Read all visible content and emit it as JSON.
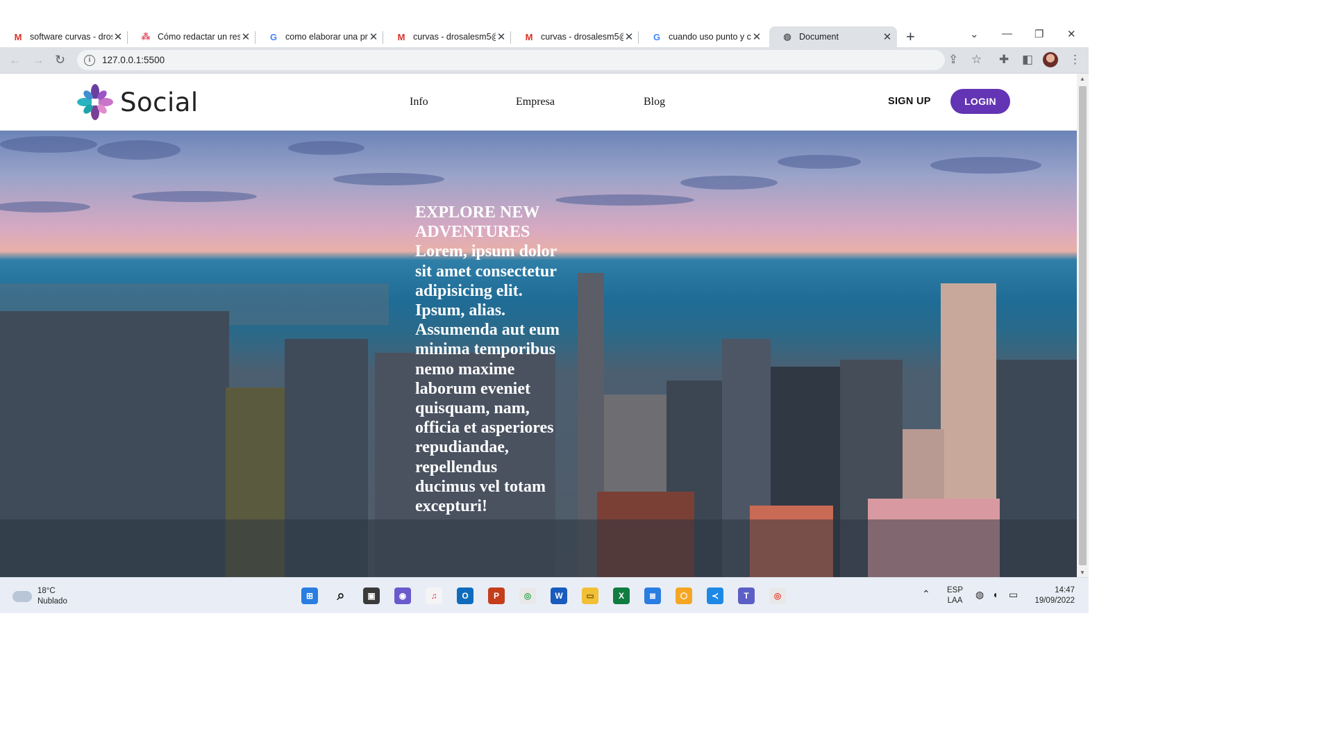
{
  "browser": {
    "tabs": [
      {
        "title": "software curvas - dros",
        "icon": "gmail-icon",
        "active": false
      },
      {
        "title": "Cómo redactar un res",
        "icon": "asana-icon",
        "active": false
      },
      {
        "title": "como elaborar una pr",
        "icon": "google-icon",
        "active": false
      },
      {
        "title": "curvas - drosalesm5@",
        "icon": "gmail-icon",
        "active": false
      },
      {
        "title": "curvas - drosalesm5@",
        "icon": "gmail-icon",
        "active": false
      },
      {
        "title": "cuando uso punto y c",
        "icon": "google-icon",
        "active": false
      },
      {
        "title": "Document",
        "icon": "globe-icon",
        "active": true
      }
    ],
    "url": "127.0.0.1:5500"
  },
  "site": {
    "brand": "Social",
    "nav": {
      "info": "Info",
      "empresa": "Empresa",
      "blog": "Blog"
    },
    "signup_label": "SIGN UP",
    "login_label": "LOGIN",
    "accent": "#6334b4",
    "hero": {
      "heading": "EXPLORE NEW ADVENTURES",
      "body": "Lorem, ipsum dolor sit amet consectetur adipisicing elit. Ipsum, alias. Assumenda aut eum minima temporibus nemo maxime laborum eveniet quisquam, nam, officia et asperiores repudiandae, repellendus ducimus vel totam excepturi!"
    }
  },
  "taskbar": {
    "weather_temp": "18°C",
    "weather_desc": "Nublado",
    "lang_top": "ESP",
    "lang_bottom": "LAA",
    "time": "14:47",
    "date": "19/09/2022"
  }
}
